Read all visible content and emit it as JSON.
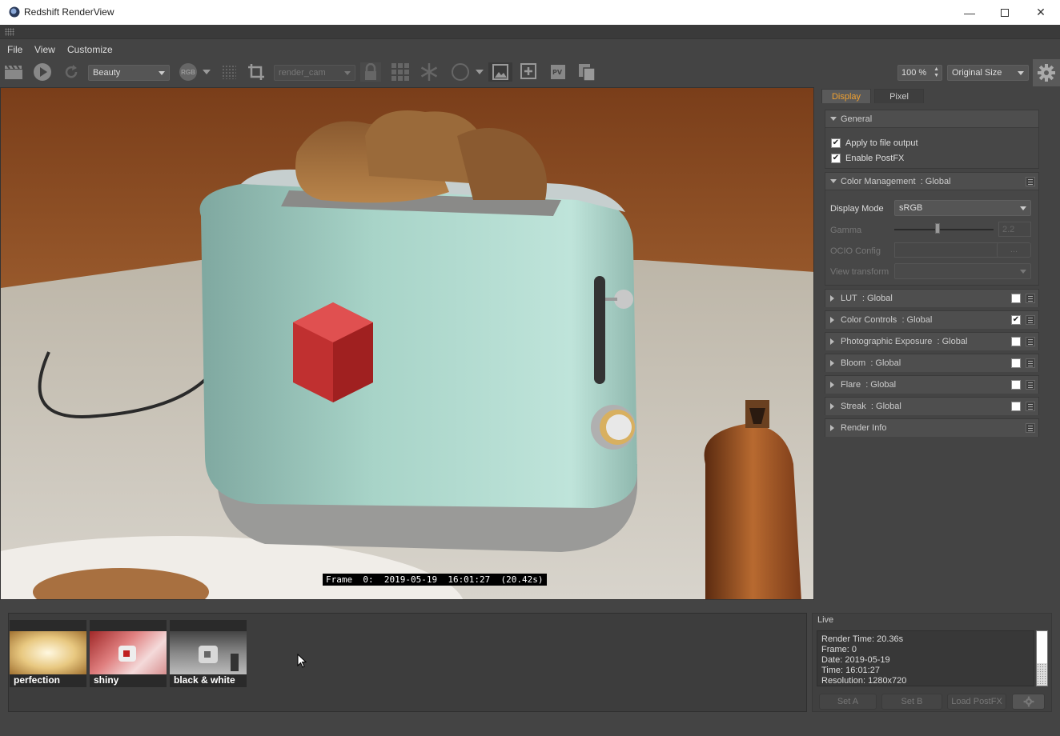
{
  "window": {
    "title": "Redshift RenderView"
  },
  "menu": [
    "File",
    "View",
    "Customize"
  ],
  "toolbar": {
    "aov": "Beauty",
    "channel_badge": "RGB",
    "camera": "render_cam",
    "zoom": "100 %",
    "size_mode": "Original Size"
  },
  "viewport": {
    "frame_info": "Frame  0:  2019-05-19  16:01:27  (20.42s)"
  },
  "panel": {
    "tabs": [
      "Display",
      "Pixel"
    ],
    "general": {
      "title": "General",
      "apply_to_file_output": "Apply to file output",
      "enable_postfx": "Enable PostFX"
    },
    "color_management": {
      "title": "Color Management",
      "scope": ": Global",
      "display_mode_label": "Display Mode",
      "display_mode_value": "sRGB",
      "gamma_label": "Gamma",
      "gamma_value": "2.2",
      "ocio_label": "OCIO Config",
      "ocio_button": "...",
      "view_transform_label": "View transform"
    },
    "sections": [
      {
        "label": "LUT",
        "scope": ": Global",
        "checked": false
      },
      {
        "label": "Color Controls",
        "scope": ": Global",
        "checked": true
      },
      {
        "label": "Photographic Exposure",
        "scope": ": Global",
        "checked": false
      },
      {
        "label": "Bloom",
        "scope": ": Global",
        "checked": false
      },
      {
        "label": "Flare",
        "scope": ": Global",
        "checked": false
      },
      {
        "label": "Streak",
        "scope": ": Global",
        "checked": false
      },
      {
        "label": "Render Info",
        "scope": "",
        "checked": null
      }
    ]
  },
  "snapshots": [
    "perfection",
    "shiny",
    "black & white"
  ],
  "live": {
    "header": "Live",
    "lines": [
      "Render Time: 20.36s",
      "Frame: 0",
      "Date: 2019-05-19",
      "Time: 16:01:27",
      "Resolution: 1280x720"
    ],
    "buttons": [
      "Set A",
      "Set B",
      "Load PostFX"
    ]
  },
  "colors": {
    "accent": "#f0a030",
    "background": "#444444"
  }
}
